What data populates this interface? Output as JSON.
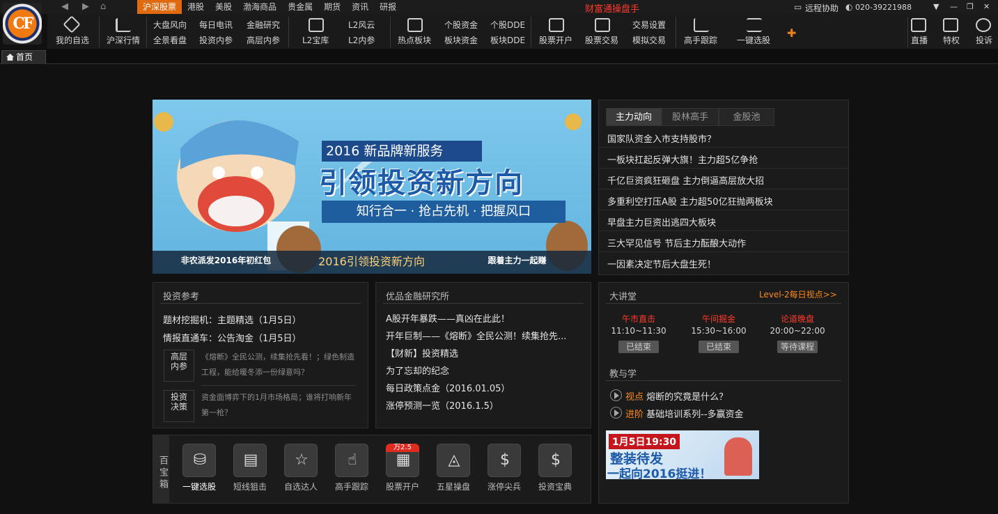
{
  "window": {
    "title": "财富通操盘手",
    "remote_help": "远程协助",
    "phone": "020-39221988",
    "controls": [
      "▼",
      "—",
      "❐",
      "✕"
    ]
  },
  "main_tabs": [
    "沪深股票",
    "港股",
    "美股",
    "渤海商品",
    "贵金属",
    "期货",
    "资讯",
    "研报"
  ],
  "toolbar": {
    "my_watchlist": "我的自选",
    "market": "沪深行情",
    "dapan": "大盘风向",
    "quanjing": "全景看盘",
    "daily_tel": "每日电讯",
    "invest_ref": "投资内参",
    "finance_research": "金融研究",
    "senior_ref": "高层内参",
    "l2_vault": "L2宝库",
    "l2_wind": "L2风云",
    "l2_inner": "L2内参",
    "hot_sector": "热点板块",
    "stock_fund": "个股资金",
    "sector_fund": "板块资金",
    "stock_dde": "个股DDE",
    "sector_dde": "板块DDE",
    "open_account": "股票开户",
    "trade": "股票交易",
    "trade_settings": "交易设置",
    "sim_trade": "模拟交易",
    "expert_follow": "高手跟踪",
    "one_click": "一键选股",
    "live": "直播",
    "privilege": "特权",
    "complaint": "投诉"
  },
  "page_tab": "首页",
  "banner": {
    "title1": "2016 新品牌新服务",
    "title2": "引领投资新方向",
    "slogan": "知行合一 · 抢占先机 · 把握风口",
    "links": [
      "非农派发2016年初红包",
      "2016引领投资新方向",
      "跟着主力一起赚"
    ]
  },
  "news": {
    "tabs": [
      "主力动向",
      "股林高手",
      "金股池"
    ],
    "items": [
      "国家队资金入市支持股市？",
      "一板块扛起反弹大旗！主力超5亿争抢",
      "千亿巨资疯狂砸盘 主力倒逼高层放大招",
      "多重利空打压A股 主力超50亿狂抛两板块",
      "早盘主力巨资出逃四大板块",
      "三大罕见信号 节后主力酝酿大动作",
      "一因素决定节后大盘生死！"
    ]
  },
  "invest_ref": {
    "title": "投资参考",
    "items": [
      "题材挖掘机：主题精选（1月5日）",
      "情报直通车：公告淘金（1月5日）"
    ],
    "badges": [
      {
        "label": "高层\n内参",
        "text": "《熔断》全民公测，续集抢先看！；绿色制造工程，能给暖冬添一份绿意吗？"
      },
      {
        "label": "投资\n决策",
        "text": "资金面博弈下的1月市场格局；谁将打响新年第一枪？"
      }
    ]
  },
  "research": {
    "title": "优品金融研究所",
    "items": [
      "A股开年暴跌——真凶在此此！",
      "开年巨制——《熔断》全民公测！续集抢先...",
      "【财新】投资精选",
      "为了忘却的纪念",
      "每日政策点金（2016.01.05）",
      "涨停预测一览（2016.1.5）"
    ]
  },
  "lecture": {
    "title": "大讲堂",
    "link": "Level-2每日视点>>",
    "sessions": [
      {
        "name": "午市直击",
        "time": "11:10~11:30",
        "status": "已结束"
      },
      {
        "name": "午间掘金",
        "time": "15:30~16:00",
        "status": "已结束"
      },
      {
        "name": "论道晚盘",
        "time": "20:00~22:00",
        "status": "等待课程"
      }
    ],
    "teach_title": "教与学",
    "teach": [
      {
        "tag": "视点",
        "text": "熔断的究竟是什么？"
      },
      {
        "tag": "进阶",
        "text": "基础培训系列--多赢资金"
      }
    ],
    "promo_date": "1月5日19:30",
    "promo_line1": "整装待发",
    "promo_line2": "一起向2016挺进！"
  },
  "toolbox": {
    "label": "百宝箱",
    "badge": "万2.5",
    "items": [
      "一键选股",
      "短线狙击",
      "自选达人",
      "高手跟踪",
      "股票开户",
      "五星操盘",
      "涨停尖兵",
      "投资宝典"
    ]
  },
  "colors": {
    "accent": "#e06a10",
    "title_red": "#ff3a2a",
    "highlight": "#ff8a1a"
  }
}
